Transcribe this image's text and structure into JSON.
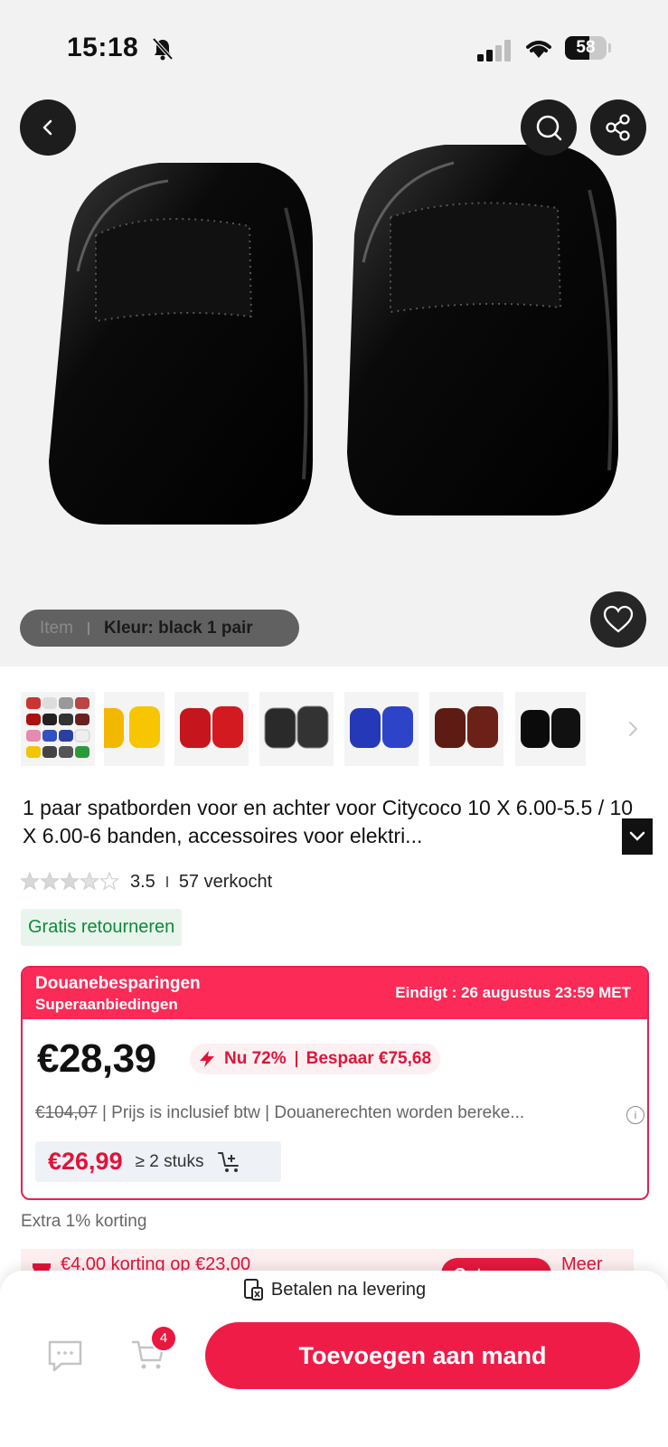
{
  "status_bar": {
    "time": "15:18",
    "battery": "58",
    "battery_level": 0.58
  },
  "hero": {
    "variant_label": "Item",
    "variant_value": "Kleur: black 1 pair"
  },
  "thumbnails": [
    {
      "name": "multi-color-set"
    },
    {
      "name": "yellow-pair"
    },
    {
      "name": "red-pair"
    },
    {
      "name": "black-marble-pair"
    },
    {
      "name": "blue-pair"
    },
    {
      "name": "brown-pair"
    },
    {
      "name": "black-pair"
    }
  ],
  "product": {
    "title": "1 paar spatborden voor en achter voor Citycoco 10 X 6.00-5.5 / 10 X 6.00-6 banden, accessoires voor elektri...",
    "rating": "3.5",
    "rating_value": 3.5,
    "sold": "57 verkocht",
    "free_returns": "Gratis retourneren"
  },
  "price_card": {
    "header_title": "Douanebesparingen",
    "header_sub": "Superaanbiedingen",
    "ends": "Eindigt : 26 augustus 23:59 MET",
    "price": "€28,39",
    "discount": "Nu 72%",
    "save": "Bespaar €75,68",
    "old_price": "€104,07",
    "info": "| Prijs is inclusief btw | Douanerechten worden bereke...",
    "bulk_price": "€26,99",
    "bulk_qty": "≥ 2 stuks"
  },
  "extra_discount": "Extra 1% korting",
  "coupon": {
    "text": "€4,00 korting op €23,00",
    "button": "Ontvangen",
    "more": "Meer"
  },
  "bottom": {
    "pay_note": "Betalen na levering",
    "cart_count": "4",
    "add_button": "Toevoegen aan mand"
  },
  "colors": {
    "accent": "#f01c48",
    "badge_green": "#0f8a3a"
  }
}
